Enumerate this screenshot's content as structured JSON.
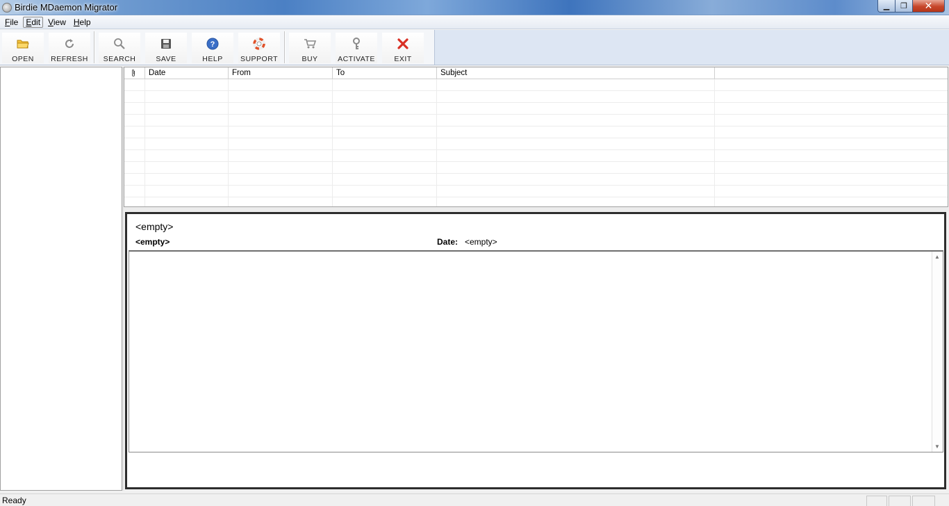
{
  "window": {
    "title": "Birdie MDaemon Migrator",
    "buttons": {
      "minimize": "▁",
      "maximize": "❐",
      "close": "✕"
    }
  },
  "menu": [
    {
      "accel": "F",
      "rest": "ile"
    },
    {
      "accel": "E",
      "rest": "dit"
    },
    {
      "accel": "V",
      "rest": "iew"
    },
    {
      "accel": "H",
      "rest": "elp"
    }
  ],
  "toolbar": {
    "open": "OPEN",
    "refresh": "REFRESH",
    "search": "SEARCH",
    "save": "SAVE",
    "help": "HELP",
    "support": "SUPPORT",
    "buy": "BUY",
    "activate": "ACTIVATE",
    "exit": "EXIT"
  },
  "list": {
    "columns": {
      "date": "Date",
      "from": "From",
      "to": "To",
      "subject": "Subject"
    },
    "row_count": 11
  },
  "preview": {
    "subject": "<empty>",
    "from": "<empty>",
    "date_label": "Date:",
    "date_value": "<empty>"
  },
  "status": {
    "text": "Ready"
  },
  "colors": {
    "title_accent": "#4b80c4",
    "close_red": "#c7462a",
    "exit_red": "#d93025",
    "help_blue": "#3b6fc7"
  }
}
